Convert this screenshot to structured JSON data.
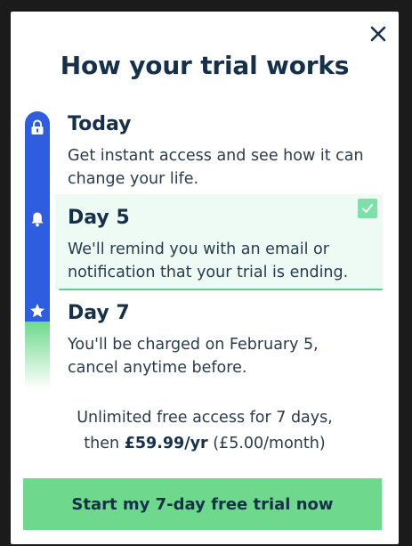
{
  "modal": {
    "title": "How your trial works",
    "close_icon": "close-icon"
  },
  "timeline": {
    "steps": [
      {
        "title": "Today",
        "description": "Get instant access and see how it can change your life.",
        "icon": "lock-icon"
      },
      {
        "title": "Day 5",
        "description": "We'll remind you with an email or notification that your trial is ending.",
        "icon": "bell-icon",
        "highlighted": true,
        "badge_icon": "check-icon"
      },
      {
        "title": "Day 7",
        "description": "You'll be charged on February 5, cancel anytime before.",
        "icon": "star-icon"
      }
    ]
  },
  "pricing": {
    "line1": "Unlimited free access for 7 days,",
    "then": "then",
    "price": "£59.99/yr",
    "monthly": "(£5.00/month)"
  },
  "cta": {
    "label": "Start my 7-day free trial now"
  },
  "colors": {
    "primary_text": "#17304a",
    "rail_blue": "#2f5de0",
    "accent_green": "#6ed98c",
    "highlight_bg": "#eefaf4"
  }
}
